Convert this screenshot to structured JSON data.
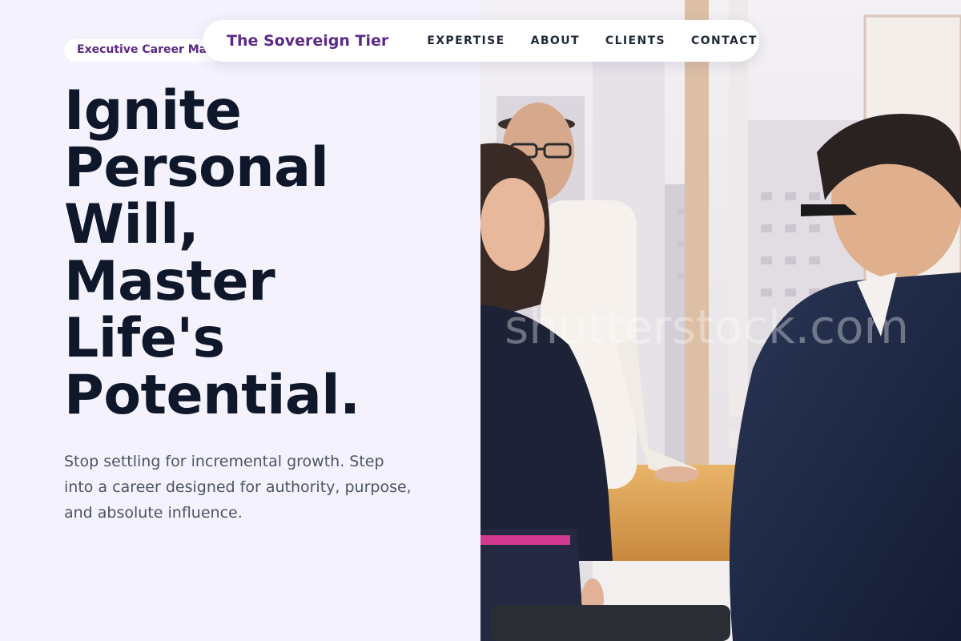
{
  "brand": {
    "name": "The Sovereign Tier"
  },
  "nav": {
    "links": [
      "EXPERTISE",
      "ABOUT",
      "CLIENTS",
      "CONTACT"
    ]
  },
  "hero": {
    "tag": "Executive Career Mastery",
    "headline_lines": [
      "Ignite",
      "Personal",
      "Will,",
      "Master",
      "Life's",
      "Potential."
    ],
    "subtext": "Stop settling for incremental growth. Step into a career designed for authority, purpose, and absolute influence."
  },
  "photo": {
    "watermark": "shutterstock.com"
  },
  "colors": {
    "accent": "#5b2a86",
    "background": "#f4f2fd",
    "headline": "#0f172a",
    "body": "#4b5563"
  }
}
